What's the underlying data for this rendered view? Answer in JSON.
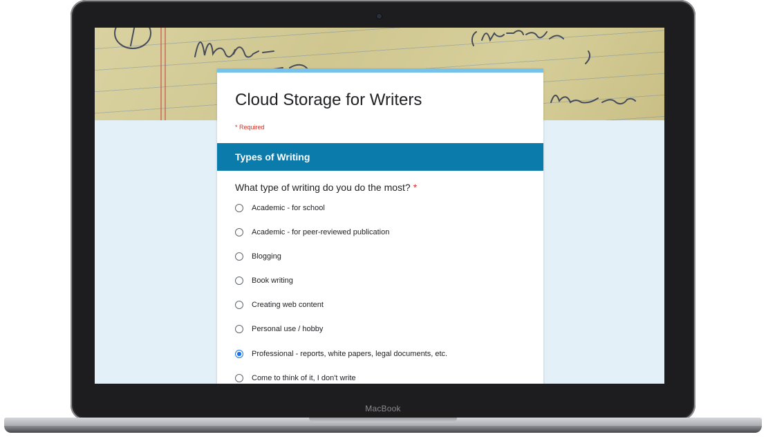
{
  "device": {
    "brand_label": "MacBook"
  },
  "form": {
    "title": "Cloud Storage for Writers",
    "required_note": "* Required",
    "section_title": "Types of Writing",
    "question": "What type of writing do you do the most?",
    "required_star": "*",
    "options": [
      {
        "label": "Academic - for school",
        "selected": false
      },
      {
        "label": "Academic - for peer-reviewed publication",
        "selected": false
      },
      {
        "label": "Blogging",
        "selected": false
      },
      {
        "label": "Book writing",
        "selected": false
      },
      {
        "label": "Creating web content",
        "selected": false
      },
      {
        "label": "Personal use / hobby",
        "selected": false
      },
      {
        "label": "Professional - reports, white papers, legal documents, etc.",
        "selected": true
      },
      {
        "label": "Come to think of it, I don't write",
        "selected": false
      }
    ]
  },
  "colors": {
    "accent_bar": "#76c2ea",
    "section_header": "#0b7bab",
    "required_red": "#d93025",
    "radio_selected": "#1a73e8",
    "page_background": "#e3f0f8"
  }
}
